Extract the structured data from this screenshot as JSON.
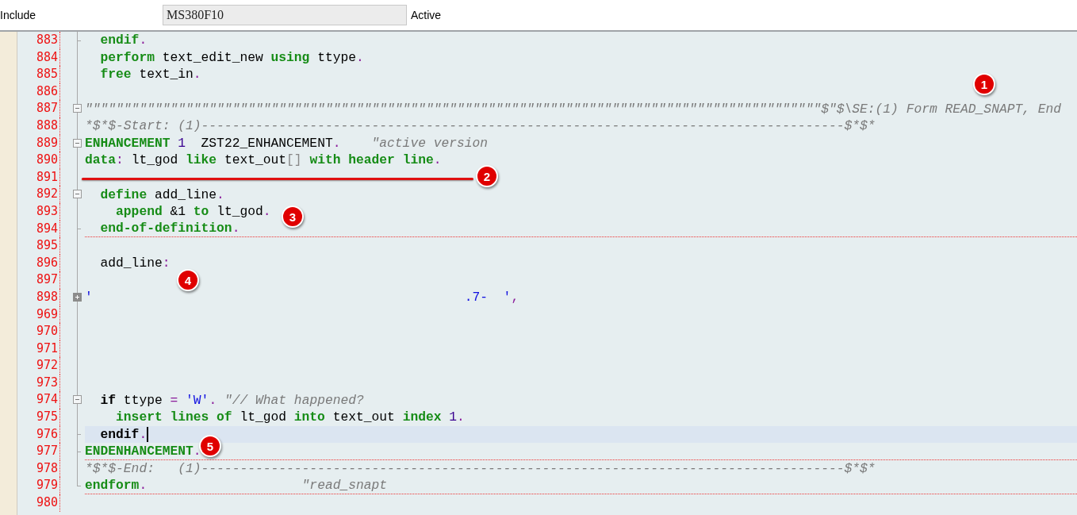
{
  "header": {
    "label": "Include",
    "field": {
      "value": "MS380F10"
    },
    "status": "Active"
  },
  "lines": [
    {
      "number": "883",
      "kind": "tick",
      "selected": false,
      "separator": false,
      "tokens": [
        {
          "kind": "kw",
          "text": "  endif"
        },
        {
          "kind": "p",
          "text": "."
        }
      ]
    },
    {
      "number": "884",
      "kind": "guide",
      "selected": false,
      "separator": false,
      "tokens": [
        {
          "kind": "kw",
          "text": "  perform"
        },
        {
          "kind": "id",
          "text": " text_edit_new "
        },
        {
          "kind": "kw",
          "text": "using"
        },
        {
          "kind": "id",
          "text": " ttype"
        },
        {
          "kind": "p",
          "text": "."
        }
      ]
    },
    {
      "number": "885",
      "kind": "guide",
      "selected": false,
      "separator": false,
      "tokens": [
        {
          "kind": "kw",
          "text": "  free"
        },
        {
          "kind": "id",
          "text": " text_in"
        },
        {
          "kind": "p",
          "text": "."
        }
      ]
    },
    {
      "number": "886",
      "kind": "guide",
      "selected": false,
      "separator": false
    },
    {
      "number": "887",
      "kind": "open",
      "selected": false,
      "separator": false,
      "tokens": [
        {
          "kind": "c",
          "text": "\"\"\"\"\"\"\"\"\"\"\"\"\"\"\"\"\"\"\"\"\"\"\"\"\"\"\"\"\"\"\"\"\"\"\"\"\"\"\"\"\"\"\"\"\"\"\"\"\"\"\"\"\"\"\"\"\"\"\"\"\"\"\"\"\"\"\"\"\"\"\"\"\"\"\"\"\"\"\"\"\"\"\"\"\"\"\"\"\"\"\"\"\"\"\"$\"$\\SE:(1) Form READ_SNAPT, End"
        }
      ]
    },
    {
      "number": "888",
      "kind": "guide",
      "selected": false,
      "separator": false,
      "tokens": [
        {
          "kind": "c",
          "text": "*$*$-Start: (1)-----------------------------------------------------------------------------------$*$*"
        }
      ]
    },
    {
      "number": "889",
      "kind": "open",
      "selected": false,
      "separator": false,
      "tokens": [
        {
          "kind": "kw",
          "text": "ENHANCEMENT"
        },
        {
          "kind": "n",
          "text": " 1"
        },
        {
          "kind": "id",
          "text": "  ZST22_ENHANCEMENT"
        },
        {
          "kind": "p",
          "text": "."
        },
        {
          "kind": "c",
          "text": "    \"active version"
        }
      ]
    },
    {
      "number": "890",
      "kind": "guide",
      "selected": false,
      "separator": false,
      "tokens": [
        {
          "kind": "kw",
          "text": "data"
        },
        {
          "kind": "p",
          "text": ":"
        },
        {
          "kind": "id",
          "text": " lt_god "
        },
        {
          "kind": "kw",
          "text": "like"
        },
        {
          "kind": "id",
          "text": " text_out"
        },
        {
          "kind": "g",
          "text": "[]"
        },
        {
          "kind": "kw",
          "text": " with header line"
        },
        {
          "kind": "p",
          "text": "."
        }
      ]
    },
    {
      "number": "891",
      "kind": "guide",
      "selected": false,
      "separator": false
    },
    {
      "number": "892",
      "kind": "open",
      "selected": false,
      "separator": false,
      "tokens": [
        {
          "kind": "kw",
          "text": "  define"
        },
        {
          "kind": "id",
          "text": " add_line"
        },
        {
          "kind": "p",
          "text": "."
        }
      ]
    },
    {
      "number": "893",
      "kind": "guide",
      "selected": false,
      "separator": false,
      "tokens": [
        {
          "kind": "kw",
          "text": "    append"
        },
        {
          "kind": "id",
          "text": " &1 "
        },
        {
          "kind": "kw",
          "text": "to"
        },
        {
          "kind": "id",
          "text": " lt_god"
        },
        {
          "kind": "p",
          "text": "."
        }
      ]
    },
    {
      "number": "894",
      "kind": "tick",
      "selected": false,
      "separator": true,
      "tokens": [
        {
          "kind": "kw",
          "text": "  end-of-definition"
        },
        {
          "kind": "p",
          "text": "."
        }
      ]
    },
    {
      "number": "895",
      "kind": "guide",
      "selected": false,
      "separator": false
    },
    {
      "number": "896",
      "kind": "guide",
      "selected": false,
      "separator": false,
      "tokens": [
        {
          "kind": "id",
          "text": "  add_line"
        },
        {
          "kind": "p",
          "text": ":"
        }
      ]
    },
    {
      "number": "897",
      "kind": "guide",
      "selected": false,
      "separator": false
    },
    {
      "number": "898",
      "kind": "closed",
      "selected": false,
      "separator": false,
      "tokens": [
        {
          "kind": "s",
          "text": "'                                                .7-  '"
        },
        {
          "kind": "p",
          "text": ","
        }
      ]
    },
    {
      "number": "969",
      "kind": "guide",
      "selected": false,
      "separator": false
    },
    {
      "number": "970",
      "kind": "guide",
      "selected": false,
      "separator": false
    },
    {
      "number": "971",
      "kind": "guide",
      "selected": false,
      "separator": false
    },
    {
      "number": "972",
      "kind": "guide",
      "selected": false,
      "separator": false
    },
    {
      "number": "973",
      "kind": "guide",
      "selected": false,
      "separator": false
    },
    {
      "number": "974",
      "kind": "open",
      "selected": false,
      "separator": false,
      "tokens": [
        {
          "kind": "ctl",
          "text": "  if"
        },
        {
          "kind": "id",
          "text": " ttype "
        },
        {
          "kind": "p",
          "text": "="
        },
        {
          "kind": "s",
          "text": " 'W'"
        },
        {
          "kind": "p",
          "text": "."
        },
        {
          "kind": "c",
          "text": " \"// What happened?"
        }
      ]
    },
    {
      "number": "975",
      "kind": "guide",
      "selected": false,
      "separator": false,
      "tokens": [
        {
          "kind": "kw",
          "text": "    insert lines of"
        },
        {
          "kind": "id",
          "text": " lt_god "
        },
        {
          "kind": "kw",
          "text": "into"
        },
        {
          "kind": "id",
          "text": " text_out "
        },
        {
          "kind": "kw",
          "text": "index"
        },
        {
          "kind": "n",
          "text": " 1"
        },
        {
          "kind": "p",
          "text": "."
        }
      ]
    },
    {
      "number": "976",
      "kind": "tick",
      "selected": true,
      "separator": false,
      "tokens": [
        {
          "kind": "ctl",
          "text": "  endif"
        },
        {
          "kind": "p",
          "text": "."
        }
      ]
    },
    {
      "number": "977",
      "kind": "tick",
      "selected": false,
      "separator": true,
      "tokens": [
        {
          "kind": "kw",
          "text": "ENDENHANCEMENT"
        },
        {
          "kind": "p",
          "text": "."
        }
      ]
    },
    {
      "number": "978",
      "kind": "guide",
      "selected": false,
      "separator": false,
      "tokens": [
        {
          "kind": "c",
          "text": "*$*$-End:   (1)-----------------------------------------------------------------------------------$*$*"
        }
      ]
    },
    {
      "number": "979",
      "kind": "end",
      "selected": false,
      "separator": true,
      "tokens": [
        {
          "kind": "kw",
          "text": "endform"
        },
        {
          "kind": "p",
          "text": "."
        },
        {
          "kind": "c",
          "text": "                    \"read_snapt"
        }
      ]
    },
    {
      "number": "980",
      "kind": "blank",
      "selected": false,
      "separator": false
    }
  ],
  "annotations": [
    {
      "kind": "marker",
      "label": "1"
    },
    {
      "kind": "underline"
    },
    {
      "kind": "marker",
      "label": "2"
    },
    {
      "kind": "marker",
      "label": "3"
    },
    {
      "kind": "marker",
      "label": "4"
    },
    {
      "kind": "marker",
      "label": "5"
    }
  ]
}
